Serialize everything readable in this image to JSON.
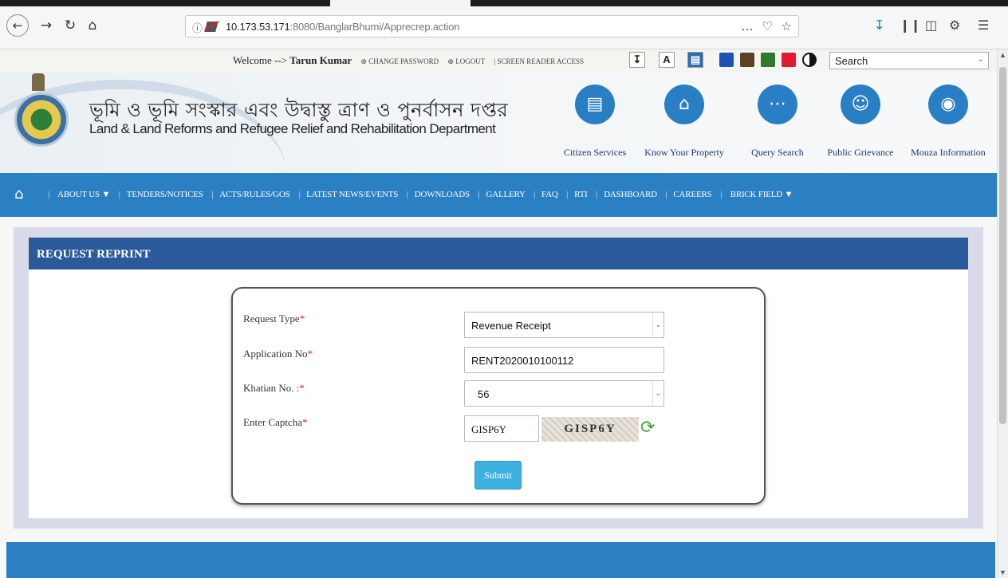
{
  "browser": {
    "url_host": "10.173.53.171",
    "url_port": ":8080",
    "url_path": "/BanglarBhumi/Apprecrep.action",
    "more_icon": "…",
    "pocket_icon": "♡",
    "star_icon": "☆"
  },
  "sitebar": {
    "welcome_prefix": "Welcome --> ",
    "user_name": "Tarun Kumar",
    "change_password": "CHANGE PASSWORD",
    "logout": "LOGOUT",
    "screen_reader": "SCREEN READER ACCESS",
    "search_placeholder": "Search",
    "theme_colors": [
      "#1d52b8",
      "#5a4222",
      "#2f7a2f",
      "#e01a32"
    ]
  },
  "header": {
    "title_bengali": "ভূমি ও ভূমি সংস্কার এবং উদ্বাস্তু ত্রাণ ও পুনর্বাসন দপ্তর",
    "title_english": "Land & Land Reforms and Refugee Relief and Rehabilitation Department",
    "services": [
      {
        "label": "Citizen Services",
        "icon": "id-card-icon"
      },
      {
        "label": "Know Your Property",
        "icon": "home-icon"
      },
      {
        "label": "Query Search",
        "icon": "chat-icon"
      },
      {
        "label": "Public Grievance",
        "icon": "people-icon"
      },
      {
        "label": "Mouza Information",
        "icon": "globe-icon"
      }
    ]
  },
  "nav": {
    "items": [
      "ABOUT US",
      "TENDERS/NOTICES",
      "ACTS/RULES/GOS",
      "LATEST NEWS/EVENTS",
      "DOWNLOADS",
      "GALLERY",
      "FAQ",
      "RTI",
      "DASHBOARD",
      "CAREERS",
      "BRICK FIELD"
    ]
  },
  "panel": {
    "title": "REQUEST REPRINT"
  },
  "form": {
    "request_type_label": "Request Type",
    "request_type_value": "Revenue Receipt",
    "application_no_label": "Application No",
    "application_no_value": "RENT2020010100112",
    "khatian_label": "Khatian No. :",
    "khatian_value": "56",
    "captcha_label": "Enter Captcha",
    "captcha_input_value": "GISP6Y",
    "captcha_image_text": "GISP6Y",
    "submit_label": "Submit",
    "required_mark": "*"
  }
}
